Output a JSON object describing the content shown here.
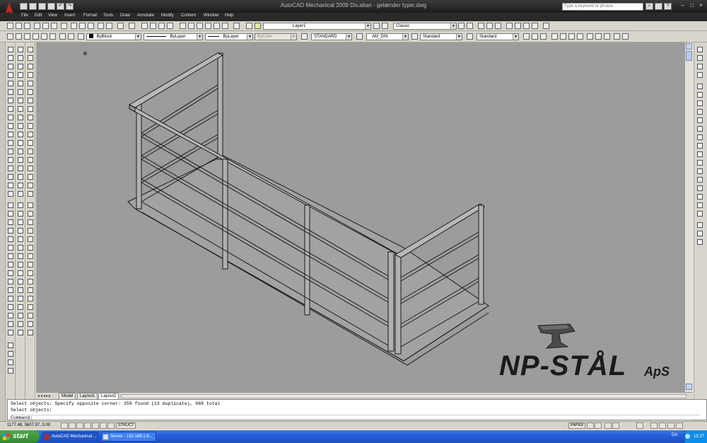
{
  "window": {
    "title": "AutoCAD Mechanical 2009  Div.altan - gelænder typer.dwg"
  },
  "search": {
    "placeholder": "Type a keyword or phrase"
  },
  "menu": [
    "File",
    "Edit",
    "View",
    "Insert",
    "Format",
    "Tools",
    "Draw",
    "Annotate",
    "Modify",
    "Content",
    "Window",
    "Help"
  ],
  "toolbar1": {
    "layer": "Layer1",
    "workspace": "Classic"
  },
  "toolbar2": {
    "color": "ByBlock",
    "linetype": "ByLayer",
    "lineweight": "ByLayer",
    "plotstyle": "ByColor",
    "textstyle": "STANDARD",
    "dimstyle": "AM_DIN",
    "tablestyle": "Standard",
    "mleaderstyle": "Standard"
  },
  "layout_tabs": [
    "Model",
    "Layout1",
    "Layout2"
  ],
  "active_tab": "Layout2",
  "command_lines": [
    "Select objects: Specify opposite corner: 359 found (13 duplicate), 668 total",
    "Select objects:",
    "Command:"
  ],
  "status": {
    "coordinates": "1177.48, 5607.97, 0.00",
    "struct_label": "STRUCT",
    "paper_label": "PAPER"
  },
  "logo": {
    "text": "NP-STÅL",
    "suffix": "ApS"
  },
  "taskbar": {
    "start_label": "start",
    "tasks": [
      "AutoCAD Mechanical ...",
      "Server - 192.168.1.8..."
    ],
    "language": "DA",
    "clock": "15:27"
  },
  "colors": {
    "canvas": "#9c9c9c",
    "titlebar": "#1c1c1c",
    "taskbar": "#245edb",
    "start": "#338a2e"
  }
}
